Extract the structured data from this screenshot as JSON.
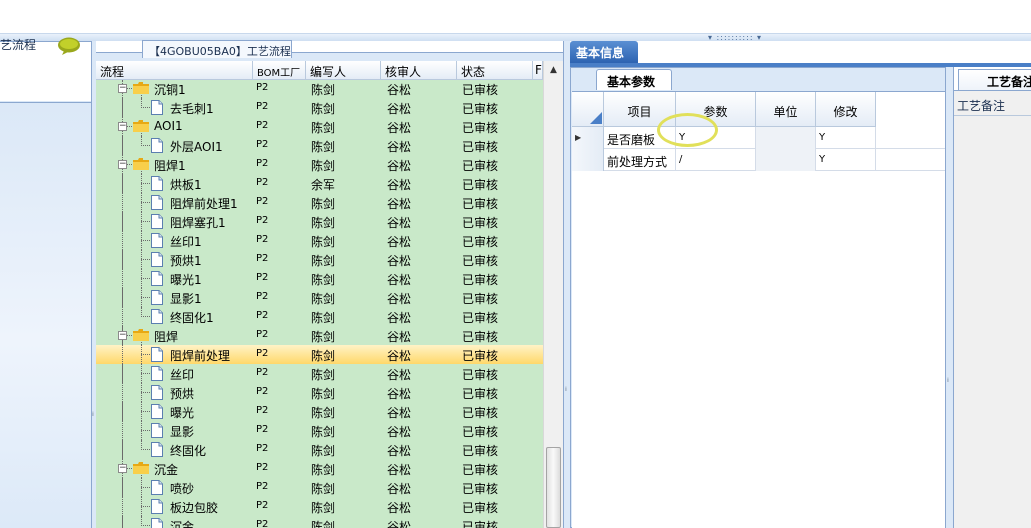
{
  "left_panel": {
    "label": "艺流程",
    "chat_icon": "speech-bubble-icon"
  },
  "middle_panel": {
    "title": "【4GOBU05BA0】工艺流程",
    "columns": [
      "流程",
      "BOM工厂",
      "编写人",
      "核审人",
      "状态",
      "F"
    ],
    "rows": [
      {
        "name": "沉铜1",
        "type": "folder",
        "level": 1,
        "bom": "P2",
        "writer": "陈剑",
        "reviewer": "谷松",
        "status": "已审核"
      },
      {
        "name": "去毛刺1",
        "type": "doc",
        "level": 2,
        "bom": "P2",
        "writer": "陈剑",
        "reviewer": "谷松",
        "status": "已审核"
      },
      {
        "name": "AOI1",
        "type": "folder",
        "level": 1,
        "bom": "P2",
        "writer": "陈剑",
        "reviewer": "谷松",
        "status": "已审核"
      },
      {
        "name": "外层AOI1",
        "type": "doc",
        "level": 2,
        "bom": "P2",
        "writer": "陈剑",
        "reviewer": "谷松",
        "status": "已审核"
      },
      {
        "name": "阻焊1",
        "type": "folder",
        "level": 1,
        "bom": "P2",
        "writer": "陈剑",
        "reviewer": "谷松",
        "status": "已审核"
      },
      {
        "name": "烘板1",
        "type": "doc",
        "level": 2,
        "bom": "P2",
        "writer": "余军",
        "reviewer": "谷松",
        "status": "已审核"
      },
      {
        "name": "阻焊前处理1",
        "type": "doc",
        "level": 2,
        "bom": "P2",
        "writer": "陈剑",
        "reviewer": "谷松",
        "status": "已审核"
      },
      {
        "name": "阻焊塞孔1",
        "type": "doc",
        "level": 2,
        "bom": "P2",
        "writer": "陈剑",
        "reviewer": "谷松",
        "status": "已审核"
      },
      {
        "name": "丝印1",
        "type": "doc",
        "level": 2,
        "bom": "P2",
        "writer": "陈剑",
        "reviewer": "谷松",
        "status": "已审核"
      },
      {
        "name": "预烘1",
        "type": "doc",
        "level": 2,
        "bom": "P2",
        "writer": "陈剑",
        "reviewer": "谷松",
        "status": "已审核"
      },
      {
        "name": "曝光1",
        "type": "doc",
        "level": 2,
        "bom": "P2",
        "writer": "陈剑",
        "reviewer": "谷松",
        "status": "已审核"
      },
      {
        "name": "显影1",
        "type": "doc",
        "level": 2,
        "bom": "P2",
        "writer": "陈剑",
        "reviewer": "谷松",
        "status": "已审核"
      },
      {
        "name": "终固化1",
        "type": "doc",
        "level": 2,
        "bom": "P2",
        "writer": "陈剑",
        "reviewer": "谷松",
        "status": "已审核"
      },
      {
        "name": "阻焊",
        "type": "folder",
        "level": 1,
        "bom": "P2",
        "writer": "陈剑",
        "reviewer": "谷松",
        "status": "已审核"
      },
      {
        "name": "阻焊前处理",
        "type": "doc",
        "level": 2,
        "bom": "P2",
        "writer": "陈剑",
        "reviewer": "谷松",
        "status": "已审核",
        "selected": true
      },
      {
        "name": "丝印",
        "type": "doc",
        "level": 2,
        "bom": "P2",
        "writer": "陈剑",
        "reviewer": "谷松",
        "status": "已审核"
      },
      {
        "name": "预烘",
        "type": "doc",
        "level": 2,
        "bom": "P2",
        "writer": "陈剑",
        "reviewer": "谷松",
        "status": "已审核"
      },
      {
        "name": "曝光",
        "type": "doc",
        "level": 2,
        "bom": "P2",
        "writer": "陈剑",
        "reviewer": "谷松",
        "status": "已审核"
      },
      {
        "name": "显影",
        "type": "doc",
        "level": 2,
        "bom": "P2",
        "writer": "陈剑",
        "reviewer": "谷松",
        "status": "已审核"
      },
      {
        "name": "终固化",
        "type": "doc",
        "level": 2,
        "bom": "P2",
        "writer": "陈剑",
        "reviewer": "谷松",
        "status": "已审核"
      },
      {
        "name": "沉金",
        "type": "folder",
        "level": 1,
        "bom": "P2",
        "writer": "陈剑",
        "reviewer": "谷松",
        "status": "已审核"
      },
      {
        "name": "喷砂",
        "type": "doc",
        "level": 2,
        "bom": "P2",
        "writer": "陈剑",
        "reviewer": "谷松",
        "status": "已审核"
      },
      {
        "name": "板边包胶",
        "type": "doc",
        "level": 2,
        "bom": "P2",
        "writer": "陈剑",
        "reviewer": "谷松",
        "status": "已审核"
      },
      {
        "name": "沉金",
        "type": "doc",
        "level": 2,
        "bom": "P2",
        "writer": "陈剑",
        "reviewer": "谷松",
        "status": "已审核"
      }
    ]
  },
  "right_panel": {
    "main_tab": "基本信息",
    "sub_tab": "基本参数",
    "param_columns": [
      "项目",
      "参数",
      "单位",
      "修改"
    ],
    "params": [
      {
        "item": "是否磨板",
        "value": "Y",
        "unit": "",
        "modify": "Y",
        "current": true
      },
      {
        "item": "前处理方式",
        "value": "/",
        "unit": "",
        "modify": "Y"
      }
    ],
    "remarks_tab": "工艺备注",
    "remarks_label": "工艺备注"
  },
  "colors": {
    "tree_bg": "#c9e9c9",
    "selected_row": "#ffd86a",
    "tab_active": "#2d63b1"
  }
}
